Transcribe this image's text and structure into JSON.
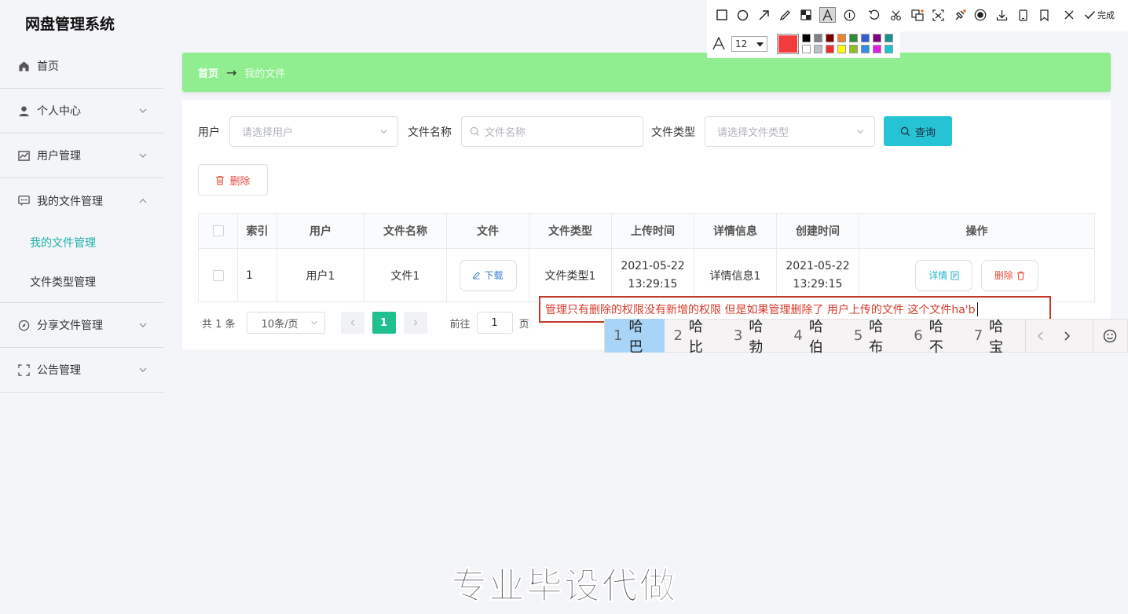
{
  "app": {
    "title": "网盘管理系统"
  },
  "sidebar": {
    "items": [
      {
        "label": "首页",
        "icon": "home-icon",
        "has_chevron": false
      },
      {
        "label": "个人中心",
        "icon": "user-icon",
        "has_chevron": true
      },
      {
        "label": "用户管理",
        "icon": "chart-icon",
        "has_chevron": true
      },
      {
        "label": "我的文件管理",
        "icon": "chat-icon",
        "has_chevron": true,
        "expanded": true
      },
      {
        "label": "分享文件管理",
        "icon": "compass-icon",
        "has_chevron": true
      },
      {
        "label": "公告管理",
        "icon": "fullscreen-icon",
        "has_chevron": true
      }
    ],
    "subitems": [
      {
        "label": "我的文件管理",
        "active": true
      },
      {
        "label": "文件类型管理",
        "active": false
      }
    ]
  },
  "breadcrumb": {
    "home": "首页",
    "arrow": "→",
    "current": "我的文件"
  },
  "filters": {
    "user_label": "用户",
    "user_placeholder": "请选择用户",
    "filename_label": "文件名称",
    "filename_placeholder": "文件名称",
    "filetype_label": "文件类型",
    "filetype_placeholder": "请选择文件类型",
    "search_button": "查询"
  },
  "actions": {
    "delete_button": "删除"
  },
  "table": {
    "headers": [
      "索引",
      "用户",
      "文件名称",
      "文件",
      "文件类型",
      "上传时间",
      "详情信息",
      "创建时间",
      "操作"
    ],
    "rows": [
      {
        "index": "1",
        "user": "用户1",
        "filename": "文件1",
        "file_button": "下载",
        "filetype": "文件类型1",
        "upload_date": "2021-05-22",
        "upload_time": "13:29:15",
        "detail": "详情信息1",
        "create_date": "2021-05-22",
        "create_time": "13:29:15",
        "detail_button": "详情",
        "delete_button": "删除"
      }
    ]
  },
  "pagination": {
    "total": "共 1 条",
    "page_size": "10条/页",
    "current_page": "1",
    "goto_label": "前往",
    "goto_value": "1",
    "page_unit": "页"
  },
  "annotation_toolbar": {
    "done_label": "完成",
    "font_size": "12",
    "current_color": "#f03c3c",
    "palette_top": [
      "#000000",
      "#808080",
      "#800000",
      "#f08030",
      "#2e8b3a",
      "#3060d0",
      "#800080",
      "#1a9090"
    ],
    "palette_bottom": [
      "#ffffff",
      "#c0c0c0",
      "#f03030",
      "#ffff00",
      "#90c020",
      "#3090e0",
      "#e020e0",
      "#20c0d0"
    ]
  },
  "annotation_text": {
    "text": "管理只有删除的权限没有新增的权限 但是如果管理删除了 用户上传的文件 这个文件ha'b"
  },
  "ime": {
    "candidates": [
      {
        "n": "1",
        "text": "哈巴"
      },
      {
        "n": "2",
        "text": "哈比"
      },
      {
        "n": "3",
        "text": "哈勃"
      },
      {
        "n": "4",
        "text": "哈伯"
      },
      {
        "n": "5",
        "text": "哈布"
      },
      {
        "n": "6",
        "text": "哈不"
      },
      {
        "n": "7",
        "text": "哈宝"
      }
    ]
  },
  "watermark": {
    "text": "专业毕设代做"
  }
}
